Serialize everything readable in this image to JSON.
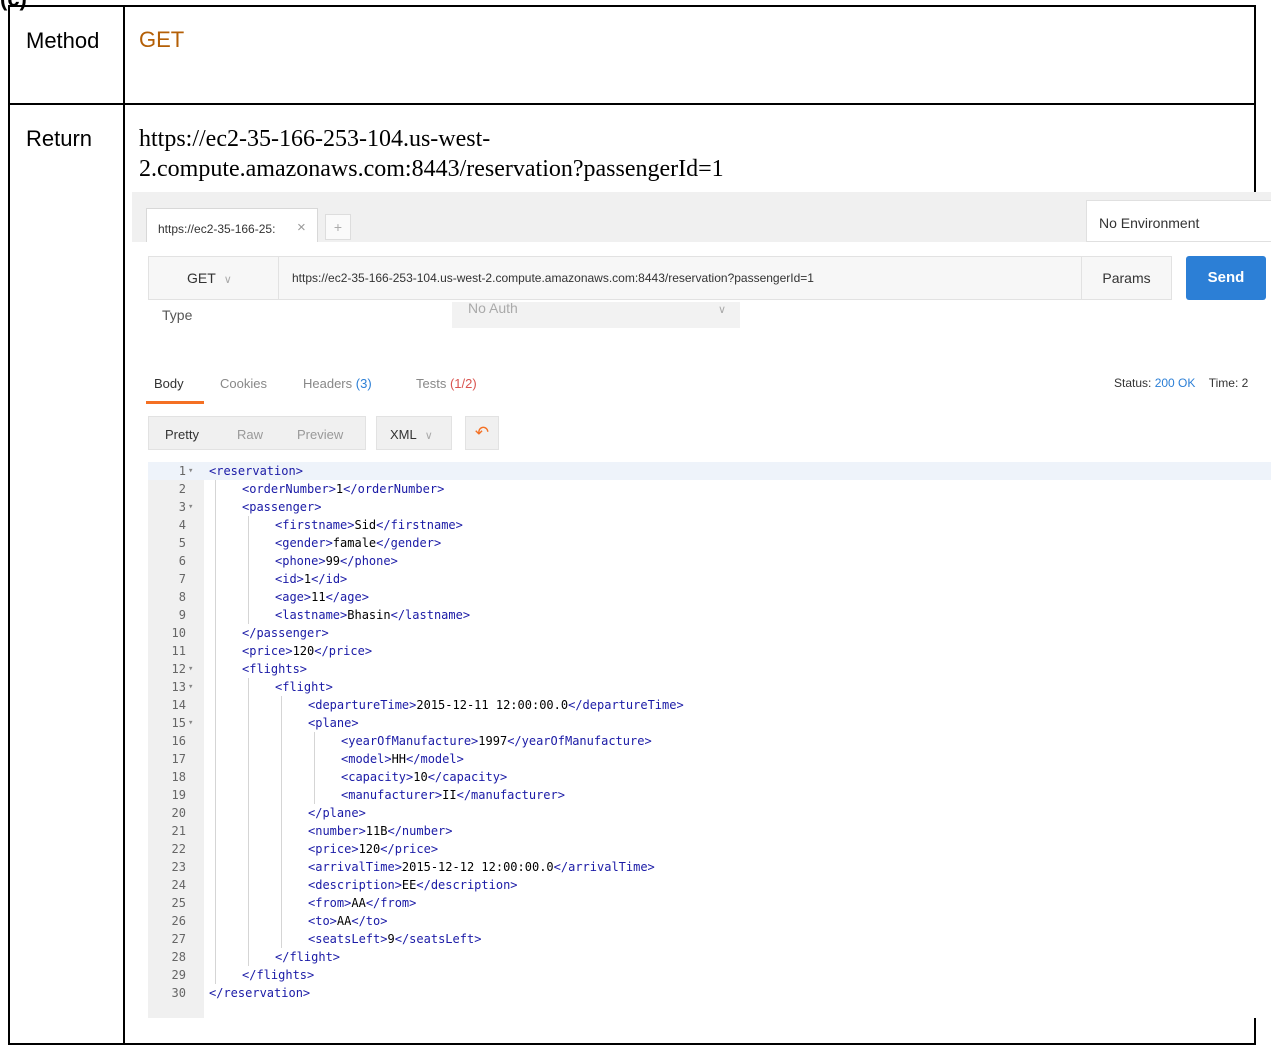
{
  "heading": "(c)",
  "method_label": "Method",
  "method_value": "GET",
  "return_label": "Return",
  "return_url_line1": "https://ec2-35-166-253-104.us-west-",
  "return_url_line2": "2.compute.amazonaws.com:8443/reservation?passengerId=1",
  "postman": {
    "tab_title": "https://ec2-35-166-25:",
    "tab_close": "×",
    "tab_add": "+",
    "environment": "No Environment",
    "method": "GET",
    "url": "https://ec2-35-166-253-104.us-west-2.compute.amazonaws.com:8443/reservation?passengerId=1",
    "params_label": "Params",
    "send_label": "Send",
    "auth_type_label": "Type",
    "auth_value": "No Auth",
    "response_tabs": {
      "body": "Body",
      "cookies": "Cookies",
      "headers": "Headers",
      "headers_count": "(3)",
      "tests": "Tests",
      "tests_count": "(1/2)"
    },
    "status_label": "Status:",
    "status_value": "200 OK",
    "time_label": "Time: 2",
    "format_options": [
      "Pretty",
      "Raw",
      "Preview"
    ],
    "format_type": "XML",
    "colors": {
      "accent": "#f47023",
      "send": "#2c7fd6",
      "method": "#b45f06"
    }
  },
  "code_lines": [
    {
      "n": 1,
      "indent": 0,
      "fold": true,
      "open": "<reservation>",
      "value": "",
      "close": ""
    },
    {
      "n": 2,
      "indent": 1,
      "fold": false,
      "open": "<orderNumber>",
      "value": "1",
      "close": "</orderNumber>"
    },
    {
      "n": 3,
      "indent": 1,
      "fold": true,
      "open": "<passenger>",
      "value": "",
      "close": ""
    },
    {
      "n": 4,
      "indent": 2,
      "fold": false,
      "open": "<firstname>",
      "value": "Sid",
      "close": "</firstname>"
    },
    {
      "n": 5,
      "indent": 2,
      "fold": false,
      "open": "<gender>",
      "value": "famale",
      "close": "</gender>"
    },
    {
      "n": 6,
      "indent": 2,
      "fold": false,
      "open": "<phone>",
      "value": "99",
      "close": "</phone>"
    },
    {
      "n": 7,
      "indent": 2,
      "fold": false,
      "open": "<id>",
      "value": "1",
      "close": "</id>"
    },
    {
      "n": 8,
      "indent": 2,
      "fold": false,
      "open": "<age>",
      "value": "11",
      "close": "</age>"
    },
    {
      "n": 9,
      "indent": 2,
      "fold": false,
      "open": "<lastname>",
      "value": "Bhasin",
      "close": "</lastname>"
    },
    {
      "n": 10,
      "indent": 1,
      "fold": false,
      "open": "</passenger>",
      "value": "",
      "close": ""
    },
    {
      "n": 11,
      "indent": 1,
      "fold": false,
      "open": "<price>",
      "value": "120",
      "close": "</price>"
    },
    {
      "n": 12,
      "indent": 1,
      "fold": true,
      "open": "<flights>",
      "value": "",
      "close": ""
    },
    {
      "n": 13,
      "indent": 2,
      "fold": true,
      "open": "<flight>",
      "value": "",
      "close": ""
    },
    {
      "n": 14,
      "indent": 3,
      "fold": false,
      "open": "<departureTime>",
      "value": "2015-12-11 12:00:00.0",
      "close": "</departureTime>"
    },
    {
      "n": 15,
      "indent": 3,
      "fold": true,
      "open": "<plane>",
      "value": "",
      "close": ""
    },
    {
      "n": 16,
      "indent": 4,
      "fold": false,
      "open": "<yearOfManufacture>",
      "value": "1997",
      "close": "</yearOfManufacture>"
    },
    {
      "n": 17,
      "indent": 4,
      "fold": false,
      "open": "<model>",
      "value": "HH",
      "close": "</model>"
    },
    {
      "n": 18,
      "indent": 4,
      "fold": false,
      "open": "<capacity>",
      "value": "10",
      "close": "</capacity>"
    },
    {
      "n": 19,
      "indent": 4,
      "fold": false,
      "open": "<manufacturer>",
      "value": "II",
      "close": "</manufacturer>"
    },
    {
      "n": 20,
      "indent": 3,
      "fold": false,
      "open": "</plane>",
      "value": "",
      "close": ""
    },
    {
      "n": 21,
      "indent": 3,
      "fold": false,
      "open": "<number>",
      "value": "11B",
      "close": "</number>"
    },
    {
      "n": 22,
      "indent": 3,
      "fold": false,
      "open": "<price>",
      "value": "120",
      "close": "</price>"
    },
    {
      "n": 23,
      "indent": 3,
      "fold": false,
      "open": "<arrivalTime>",
      "value": "2015-12-12 12:00:00.0",
      "close": "</arrivalTime>"
    },
    {
      "n": 24,
      "indent": 3,
      "fold": false,
      "open": "<description>",
      "value": "EE",
      "close": "</description>"
    },
    {
      "n": 25,
      "indent": 3,
      "fold": false,
      "open": "<from>",
      "value": "AA",
      "close": "</from>"
    },
    {
      "n": 26,
      "indent": 3,
      "fold": false,
      "open": "<to>",
      "value": "AA",
      "close": "</to>"
    },
    {
      "n": 27,
      "indent": 3,
      "fold": false,
      "open": "<seatsLeft>",
      "value": "9",
      "close": "</seatsLeft>"
    },
    {
      "n": 28,
      "indent": 2,
      "fold": false,
      "open": "</flight>",
      "value": "",
      "close": ""
    },
    {
      "n": 29,
      "indent": 1,
      "fold": false,
      "open": "</flights>",
      "value": "",
      "close": ""
    },
    {
      "n": 30,
      "indent": 0,
      "fold": false,
      "open": "</reservation>",
      "value": "",
      "close": ""
    }
  ]
}
